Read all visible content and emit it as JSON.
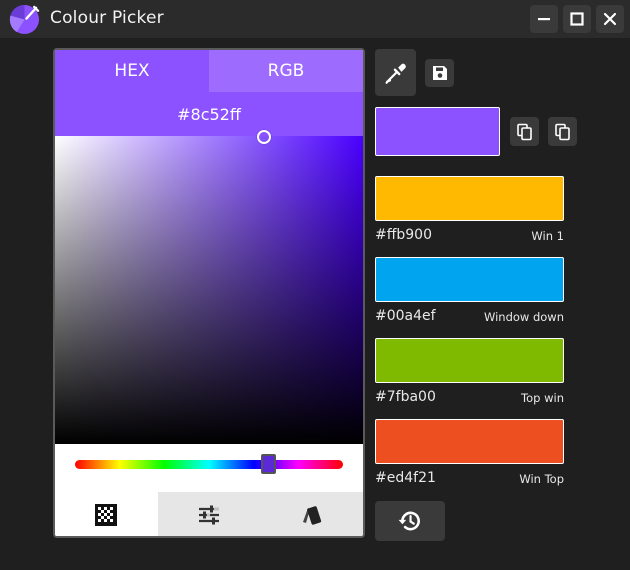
{
  "app": {
    "title": "Colour Picker"
  },
  "window_controls": [
    "minimize",
    "maximize",
    "close"
  ],
  "picker": {
    "tabs": [
      {
        "label": "HEX",
        "selected": true
      },
      {
        "label": "RGB",
        "selected": false
      }
    ],
    "hex_value": "#8c52ff",
    "accent_color": "#8c52ff",
    "hue_color": "#4a00ff",
    "bottom_tabs": [
      {
        "icon": "checkerboard-icon",
        "selected": true
      },
      {
        "icon": "sliders-icon",
        "selected": false
      },
      {
        "icon": "swatches-icon",
        "selected": false
      }
    ]
  },
  "current_color": "#8c52ff",
  "saved_colors": [
    {
      "hex": "#ffb900",
      "name": "Win 1"
    },
    {
      "hex": "#00a4ef",
      "name": "Window down"
    },
    {
      "hex": "#7fba00",
      "name": "Top win"
    },
    {
      "hex": "#ed4f21",
      "name": "Win Top"
    }
  ]
}
